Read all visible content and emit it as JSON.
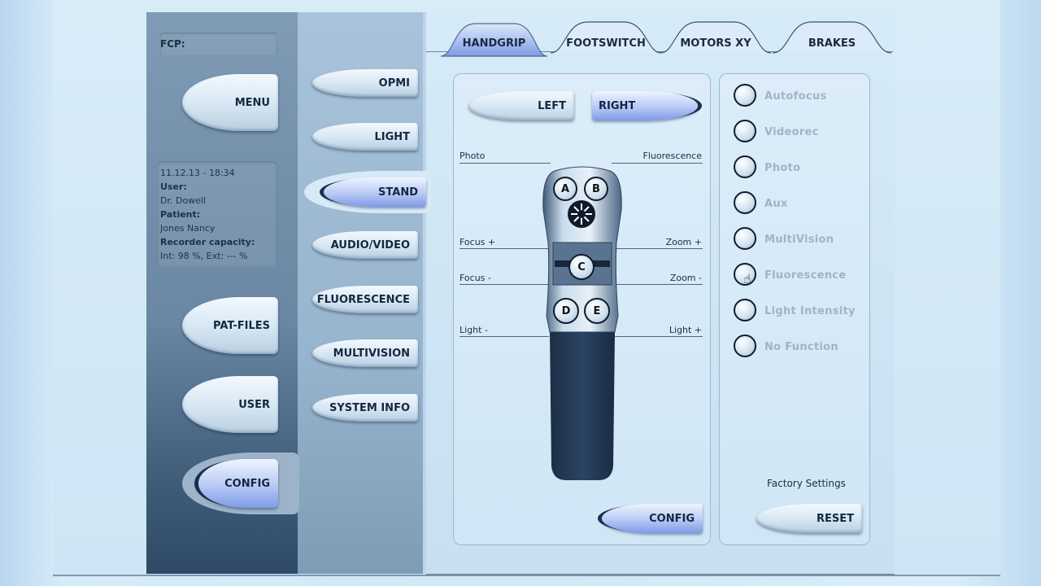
{
  "left_panel": {
    "fcp_label": "FCP:",
    "menu_button": "MENU",
    "info": {
      "datetime": "11.12.13 - 18:34",
      "user_label": "User:",
      "user_value": "Dr. Dowell",
      "patient_label": "Patient:",
      "patient_value": "Jones Nancy",
      "recorder_label": "Recorder capacity:",
      "recorder_value": "Int: 98 %, Ext: --- %"
    },
    "pat_files_button": "PAT-FILES",
    "user_button": "USER",
    "config_button": "CONFIG"
  },
  "mid_menu": {
    "items": [
      {
        "label": "OPMI",
        "active": false
      },
      {
        "label": "LIGHT",
        "active": false
      },
      {
        "label": "STAND",
        "active": true
      },
      {
        "label": "AUDIO/VIDEO",
        "active": false
      },
      {
        "label": "FLUORESCENCE",
        "active": false
      },
      {
        "label": "MULTIVISION",
        "active": false
      },
      {
        "label": "SYSTEM INFO",
        "active": false
      }
    ]
  },
  "tabs": [
    {
      "label": "HANDGRIP",
      "active": true
    },
    {
      "label": "FOOTSWITCH",
      "active": false
    },
    {
      "label": "MOTORS XY",
      "active": false
    },
    {
      "label": "BRAKES",
      "active": false
    }
  ],
  "handgrip": {
    "left_button": "LEFT",
    "right_button": "RIGHT",
    "selected_side": "RIGHT",
    "labels": {
      "photo": "Photo",
      "fluorescence": "Fluorescence",
      "focus_plus": "Focus +",
      "zoom_plus": "Zoom +",
      "focus_minus": "Focus -",
      "zoom_minus": "Zoom -",
      "light_minus": "Light -",
      "light_plus": "Light +"
    },
    "buttons": {
      "a": "A",
      "b": "B",
      "c": "C",
      "d": "D",
      "e": "E"
    },
    "config_button": "CONFIG"
  },
  "functions": {
    "options": [
      {
        "label": "Autofocus"
      },
      {
        "label": "Videorec"
      },
      {
        "label": "Photo"
      },
      {
        "label": "Aux"
      },
      {
        "label": "MultiVision"
      },
      {
        "label": "Fluorescence"
      },
      {
        "label": "Light Intensity"
      },
      {
        "label": "No Function"
      }
    ],
    "factory_label": "Factory Settings",
    "reset_button": "RESET"
  },
  "colors": {
    "active_accent": "#8aa3ec",
    "dark_panel": "#2e4a66",
    "disabled_text": "#9fb4c9"
  }
}
